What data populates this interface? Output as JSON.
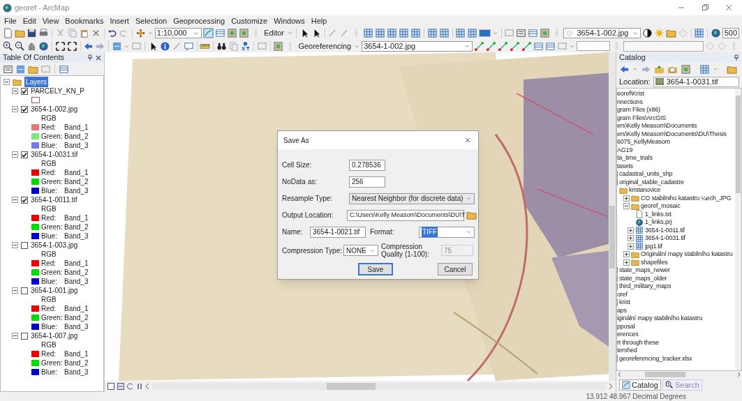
{
  "window": {
    "title": "georef - ArcMap"
  },
  "menu": [
    "File",
    "Edit",
    "View",
    "Bookmarks",
    "Insert",
    "Selection",
    "Geoprocessing",
    "Customize",
    "Windows",
    "Help"
  ],
  "toolbar": {
    "scale": "1:10,000",
    "editor": "Editor",
    "layer": "3654-1-002.jpg",
    "transparency": "500"
  },
  "georef_toolbar": {
    "label": "Georeferencing",
    "layer": "3654-1-002.jpg"
  },
  "toc": {
    "title": "Table Of Contents",
    "root": {
      "label": "Layers",
      "selected": true,
      "expanded": true
    },
    "layers": [
      {
        "name": "PARCELY_KN_P",
        "checked": true,
        "expanded": true,
        "kind": "polygon"
      },
      {
        "name": "3654-1-002.jpg",
        "checked": true,
        "expanded": true,
        "kind": "rgb",
        "legend_title": "RGB",
        "bands": [
          {
            "label": "Red:",
            "value": "Band_1",
            "color": "#e87878"
          },
          {
            "label": "Green:",
            "value": "Band_2",
            "color": "#7de87d"
          },
          {
            "label": "Blue:",
            "value": "Band_3",
            "color": "#7878e8"
          }
        ]
      },
      {
        "name": "3654-1-0031.tif",
        "checked": true,
        "expanded": true,
        "kind": "rgb",
        "legend_title": "RGB",
        "bands": [
          {
            "label": "Red:",
            "value": "Band_1",
            "color": "#ee0000"
          },
          {
            "label": "Green:",
            "value": "Band_2",
            "color": "#00dd00"
          },
          {
            "label": "Blue:",
            "value": "Band_3",
            "color": "#0000cc"
          }
        ]
      },
      {
        "name": "3654-1-0011.tif",
        "checked": true,
        "expanded": true,
        "kind": "rgb",
        "legend_title": "RGB",
        "bands": [
          {
            "label": "Red:",
            "value": "Band_1",
            "color": "#ee0000"
          },
          {
            "label": "Green:",
            "value": "Band_2",
            "color": "#00dd00"
          },
          {
            "label": "Blue:",
            "value": "Band_3",
            "color": "#0000cc"
          }
        ]
      },
      {
        "name": "3654-1-003.jpg",
        "checked": false,
        "expanded": true,
        "kind": "rgb",
        "legend_title": "RGB",
        "bands": [
          {
            "label": "Red:",
            "value": "Band_1",
            "color": "#ee0000"
          },
          {
            "label": "Green:",
            "value": "Band_2",
            "color": "#00dd00"
          },
          {
            "label": "Blue:",
            "value": "Band_3",
            "color": "#0000cc"
          }
        ]
      },
      {
        "name": "3654-1-001.jpg",
        "checked": false,
        "expanded": true,
        "kind": "rgb",
        "legend_title": "RGB",
        "bands": [
          {
            "label": "Red:",
            "value": "Band_1",
            "color": "#ee0000"
          },
          {
            "label": "Green:",
            "value": "Band_2",
            "color": "#00dd00"
          },
          {
            "label": "Blue:",
            "value": "Band_3",
            "color": "#0000cc"
          }
        ]
      },
      {
        "name": "3654-1-007.jpg",
        "checked": false,
        "expanded": true,
        "kind": "rgb",
        "legend_title": "RGB",
        "bands": [
          {
            "label": "Red:",
            "value": "Band_1",
            "color": "#ee0000"
          },
          {
            "label": "Green:",
            "value": "Band_2",
            "color": "#00dd00"
          },
          {
            "label": "Blue:",
            "value": "Band_3",
            "color": "#0000cc"
          }
        ]
      }
    ]
  },
  "dialog": {
    "title": "Save As",
    "cell_size": {
      "label": "Cell Size:",
      "value": "0.278536"
    },
    "nodata": {
      "label": "NoData as:",
      "value": "256"
    },
    "resample": {
      "label": "Resample Type:",
      "value": "Nearest Neighbor (for discrete data)"
    },
    "output": {
      "label": "Output Location:",
      "value": "C:\\Users\\Kelly Measom\\Documents\\DU\\T"
    },
    "name": {
      "label": "Name:",
      "value": "3654-1-0021.tif"
    },
    "format": {
      "label": "Format:",
      "value": "TIFF",
      "selected": true
    },
    "compression": {
      "label": "Compression Type:",
      "value": "NONE"
    },
    "quality": {
      "label": "Compression Quality (1-100):",
      "value": "75",
      "disabled": true
    },
    "buttons": [
      "Save",
      "Cancel"
    ]
  },
  "catalog": {
    "title": "Catalog",
    "location_label": "Location:",
    "location": "3654-1-0031.tif",
    "items": [
      {
        "label": "eoref\\Krist",
        "kind": "plain"
      },
      {
        "label": "nnections",
        "kind": "plain"
      },
      {
        "label": "gram Files (x86)",
        "kind": "plain"
      },
      {
        "label": "gram Files\\ArcGIS",
        "kind": "plain"
      },
      {
        "label": "ers\\Kelly Measom\\Documents",
        "kind": "plain"
      },
      {
        "label": "ers\\Kelly Measom\\Documents\\DU\\Thesis",
        "kind": "plain"
      },
      {
        "label": "6075_KellyMeasom",
        "kind": "plain"
      },
      {
        "label": "AG19",
        "kind": "plain"
      },
      {
        "label": "ta_time_trials",
        "kind": "plain"
      },
      {
        "label": "tasets",
        "kind": "plain"
      },
      {
        "label": "cadastral_units_shp",
        "kind": "line"
      },
      {
        "label": "original_stable_cadastre",
        "kind": "line",
        "children": [
          {
            "label": "kristanovice",
            "kind": "folder",
            "children": [
              {
                "label": "CO stabilniho katastru ¼ech_JPG",
                "kind": "folder",
                "expanded": false
              },
              {
                "label": "georef_mosaic",
                "kind": "folder",
                "expanded": true,
                "children": [
                  {
                    "label": "1_links.txt",
                    "kind": "text-file"
                  },
                  {
                    "label": "1_links.prj",
                    "kind": "prj-file"
                  },
                  {
                    "label": "3654-1-0011.tif",
                    "kind": "raster",
                    "expanded": false
                  },
                  {
                    "label": "3654-1-0031.tif",
                    "kind": "raster",
                    "expanded": false
                  },
                  {
                    "label": "jpg1.tif",
                    "kind": "raster",
                    "expanded": false
                  }
                ]
              },
              {
                "label": "Originální mapy stabilního katastru",
                "kind": "folder",
                "expanded": false
              },
              {
                "label": "shapefiles",
                "kind": "folder",
                "expanded": false
              }
            ]
          }
        ]
      },
      {
        "label": "state_maps_newer",
        "kind": "line"
      },
      {
        "label": "state_maps_older",
        "kind": "line"
      },
      {
        "label": "third_military_maps",
        "kind": "line"
      },
      {
        "label": "oref",
        "kind": "plain"
      },
      {
        "label": "krist",
        "kind": "line"
      },
      {
        "label": "aps",
        "kind": "plain"
      },
      {
        "label": "iginální mapy stabilního katastru",
        "kind": "plain"
      },
      {
        "label": "pposal",
        "kind": "plain"
      },
      {
        "label": "erences",
        "kind": "plain"
      },
      {
        "label": "rt through these",
        "kind": "plain"
      },
      {
        "label": "tershed",
        "kind": "plain"
      },
      {
        "label": "georeferencing_tracker.xlsx",
        "kind": "line"
      }
    ],
    "tabs": [
      {
        "label": "Catalog",
        "selected": true
      },
      {
        "label": "Search",
        "selected": false
      }
    ]
  },
  "status_bar": {
    "coordinates": "13.912  48.967 Decimal Degrees"
  }
}
